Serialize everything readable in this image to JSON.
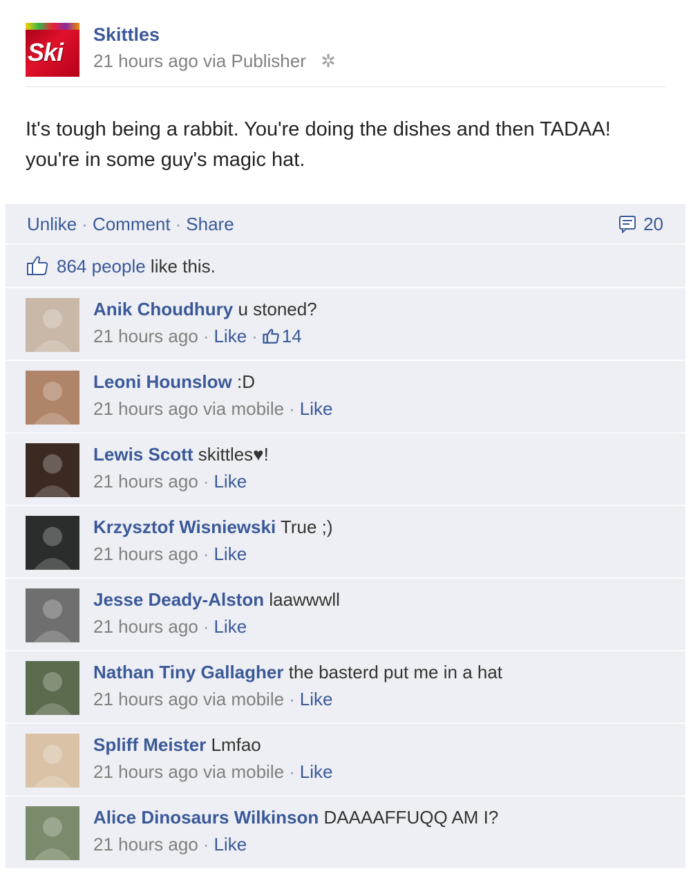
{
  "post": {
    "page_name": "Skittles",
    "logo_text": "Ski",
    "time": "21 hours ago",
    "via": "via Publisher",
    "gear_icon": "gear-icon",
    "text": "It's tough being a rabbit. You're doing the dishes and then TADAA! you're in some guy's magic hat."
  },
  "actions": {
    "unlike": "Unlike",
    "comment": "Comment",
    "share": "Share",
    "separator": "·",
    "comment_count": "20",
    "comment_icon": "comment-count-icon"
  },
  "likes": {
    "count_text": "864 people",
    "suffix": " like this.",
    "icon": "thumbs-up-icon"
  },
  "comments": [
    {
      "name": "Anik Choudhury",
      "text": "u stoned?",
      "meta": "21 hours ago",
      "like": "Like",
      "likes": "14",
      "avatar_color": "#c9b8a8"
    },
    {
      "name": "Leoni Hounslow",
      "text": ":D",
      "meta": "21 hours ago via mobile",
      "like": "Like",
      "likes": "",
      "avatar_color": "#b08468"
    },
    {
      "name": "Lewis Scott",
      "text": "skittles♥!",
      "meta": "21 hours ago",
      "like": "Like",
      "likes": "",
      "avatar_color": "#3a2a22"
    },
    {
      "name": "Krzysztof Wisniewski",
      "text": "True ;)",
      "meta": "21 hours ago",
      "like": "Like",
      "likes": "",
      "avatar_color": "#2a2d2b"
    },
    {
      "name": "Jesse Deady-Alston",
      "text": "laawwwll",
      "meta": "21 hours ago",
      "like": "Like",
      "likes": "",
      "avatar_color": "#6f6f6f"
    },
    {
      "name": "Nathan Tiny Gallagher",
      "text": "the basterd put me in a hat",
      "meta": "21 hours ago via mobile",
      "like": "Like",
      "likes": "",
      "avatar_color": "#5c6b4e"
    },
    {
      "name": "Spliff Meister",
      "text": "Lmfao",
      "meta": "21 hours ago via mobile",
      "like": "Like",
      "likes": "",
      "avatar_color": "#d9c2a6"
    },
    {
      "name": "Alice Dinosaurs Wilkinson",
      "text": "DAAAAFFUQQ AM I?",
      "meta": "21 hours ago",
      "like": "Like",
      "likes": "",
      "avatar_color": "#7a8a6a"
    }
  ]
}
